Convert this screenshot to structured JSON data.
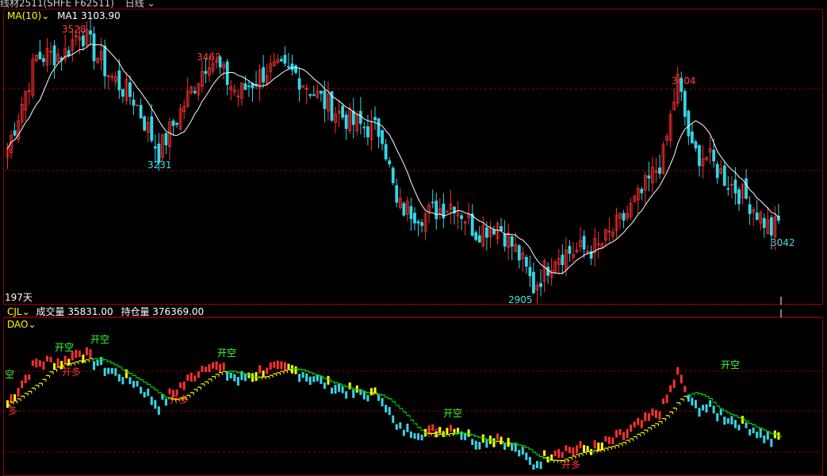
{
  "header": {
    "instrument": "线材2511(SHFE F62511)",
    "period": "日线",
    "indicator_name": "MA(10)",
    "ma_label": "MA1",
    "ma_value": "3103.90",
    "days_label": "197天"
  },
  "volume_bar": {
    "indicator": "CJL",
    "volume_label": "成交量",
    "volume_value": "35831.00",
    "oi_label": "持仓量",
    "oi_value": "376369.00"
  },
  "lower_panel": {
    "indicator": "DAO",
    "signals": [
      "开空",
      "开多",
      "开空",
      "开空",
      "开多",
      "开空",
      "开多",
      "开多",
      "开空",
      "空",
      "多"
    ]
  },
  "price_annotations": [
    "3528",
    "3462",
    "3231",
    "2905",
    "3404",
    "3042"
  ],
  "colors": {
    "background": "#000000",
    "up": "#ff3030",
    "down": "#33d6e6",
    "ma": "#ffffff",
    "grid": "#8b0000",
    "neutral": "#ffff00",
    "stair": "#00dd00",
    "header_text": "#ffff00",
    "high_label": "#ff4040",
    "low_label": "#40e0e0"
  },
  "chart_data": {
    "type": "candlestick",
    "series": [
      {
        "name": "MA1",
        "type": "line"
      }
    ],
    "anchors": [
      {
        "i": 0,
        "v": 3240
      },
      {
        "i": 8,
        "v": 3460
      },
      {
        "i": 16,
        "v": 3470
      },
      {
        "i": 20,
        "v": 3528
      },
      {
        "i": 28,
        "v": 3420
      },
      {
        "i": 35,
        "v": 3360
      },
      {
        "i": 42,
        "v": 3231
      },
      {
        "i": 48,
        "v": 3330
      },
      {
        "i": 56,
        "v": 3462
      },
      {
        "i": 64,
        "v": 3370
      },
      {
        "i": 72,
        "v": 3430
      },
      {
        "i": 80,
        "v": 3420
      },
      {
        "i": 88,
        "v": 3350
      },
      {
        "i": 96,
        "v": 3300
      },
      {
        "i": 104,
        "v": 3280
      },
      {
        "i": 108,
        "v": 3100
      },
      {
        "i": 116,
        "v": 3080
      },
      {
        "i": 124,
        "v": 3110
      },
      {
        "i": 130,
        "v": 3040
      },
      {
        "i": 136,
        "v": 3060
      },
      {
        "i": 142,
        "v": 2980
      },
      {
        "i": 146,
        "v": 2905
      },
      {
        "i": 152,
        "v": 2985
      },
      {
        "i": 164,
        "v": 3000
      },
      {
        "i": 170,
        "v": 3060
      },
      {
        "i": 176,
        "v": 3130
      },
      {
        "i": 182,
        "v": 3220
      },
      {
        "i": 186,
        "v": 3404
      },
      {
        "i": 190,
        "v": 3230
      },
      {
        "i": 194,
        "v": 3220
      },
      {
        "i": 200,
        "v": 3160
      },
      {
        "i": 206,
        "v": 3110
      },
      {
        "i": 212,
        "v": 3042
      },
      {
        "i": 214,
        "v": 3060
      }
    ],
    "y_range": [
      2880,
      3560
    ],
    "candle_count": 215
  }
}
